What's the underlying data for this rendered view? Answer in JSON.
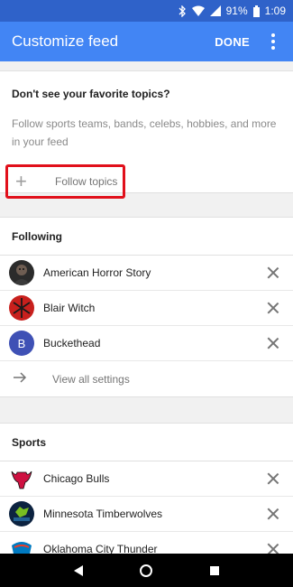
{
  "status": {
    "battery": "91%",
    "time": "1:09"
  },
  "app_bar": {
    "title": "Customize feed",
    "done_label": "DONE"
  },
  "discover": {
    "heading": "Don't see your favorite topics?",
    "description": "Follow sports teams, bands, celebs, hobbies, and more in your feed",
    "follow_topics_label": "Follow topics"
  },
  "following": {
    "title": "Following",
    "items": [
      {
        "name": "American Horror Story",
        "avatar": "american-horror-story-avatar"
      },
      {
        "name": "Blair Witch",
        "avatar": "blair-witch-avatar"
      },
      {
        "name": "Buckethead",
        "avatar_letter": "B",
        "avatar_color": "#3f51b5"
      }
    ],
    "view_all_label": "View all settings"
  },
  "sports": {
    "title": "Sports",
    "items": [
      {
        "name": "Chicago Bulls",
        "avatar": "chicago-bulls-logo"
      },
      {
        "name": "Minnesota Timberwolves",
        "avatar": "minnesota-timberwolves-logo"
      },
      {
        "name": "Oklahoma City Thunder",
        "avatar": "okc-thunder-logo"
      }
    ]
  },
  "colors": {
    "app_bar": "#4285f4",
    "status_bar": "#2f62c9",
    "highlight": "#e1101b"
  }
}
